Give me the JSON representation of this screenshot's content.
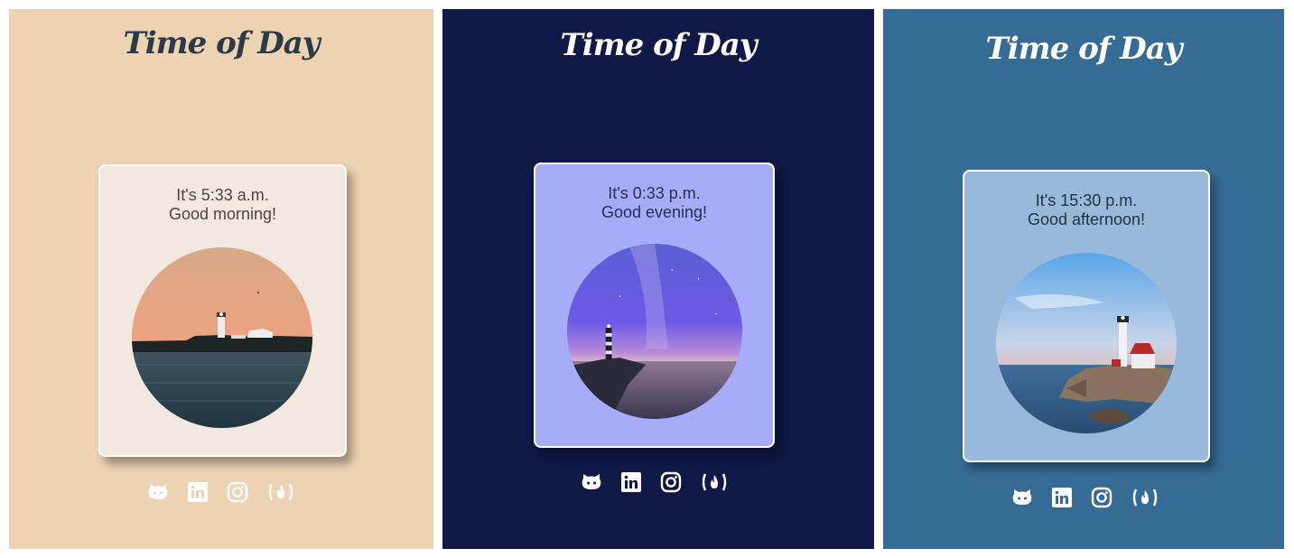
{
  "panels": [
    {
      "title": "Time of Day",
      "time_text": "It's 5:33 a.m.",
      "greeting": "Good morning!",
      "photo": "lighthouse-dawn",
      "colors": {
        "background": "#edd3b4",
        "card": "#f1e9e0",
        "title": "#2a3b45",
        "text": "#4a4642"
      }
    },
    {
      "title": "Time of Day",
      "time_text": "It's 0:33 p.m.",
      "greeting": "Good evening!",
      "photo": "lighthouse-night",
      "colors": {
        "background": "#0f1846",
        "card": "#a6acf7",
        "title": "#ffffff",
        "text": "#2a2f4e"
      }
    },
    {
      "title": "Time of Day",
      "time_text": "It's 15:30 p.m.",
      "greeting": "Good afternoon!",
      "photo": "lighthouse-afternoon",
      "colors": {
        "background": "#356c96",
        "card": "#98b9d9",
        "title": "#ffffff",
        "text": "#22323f"
      }
    }
  ],
  "social_icons": [
    "github-icon",
    "linkedin-icon",
    "instagram-icon",
    "freecodecamp-icon"
  ]
}
